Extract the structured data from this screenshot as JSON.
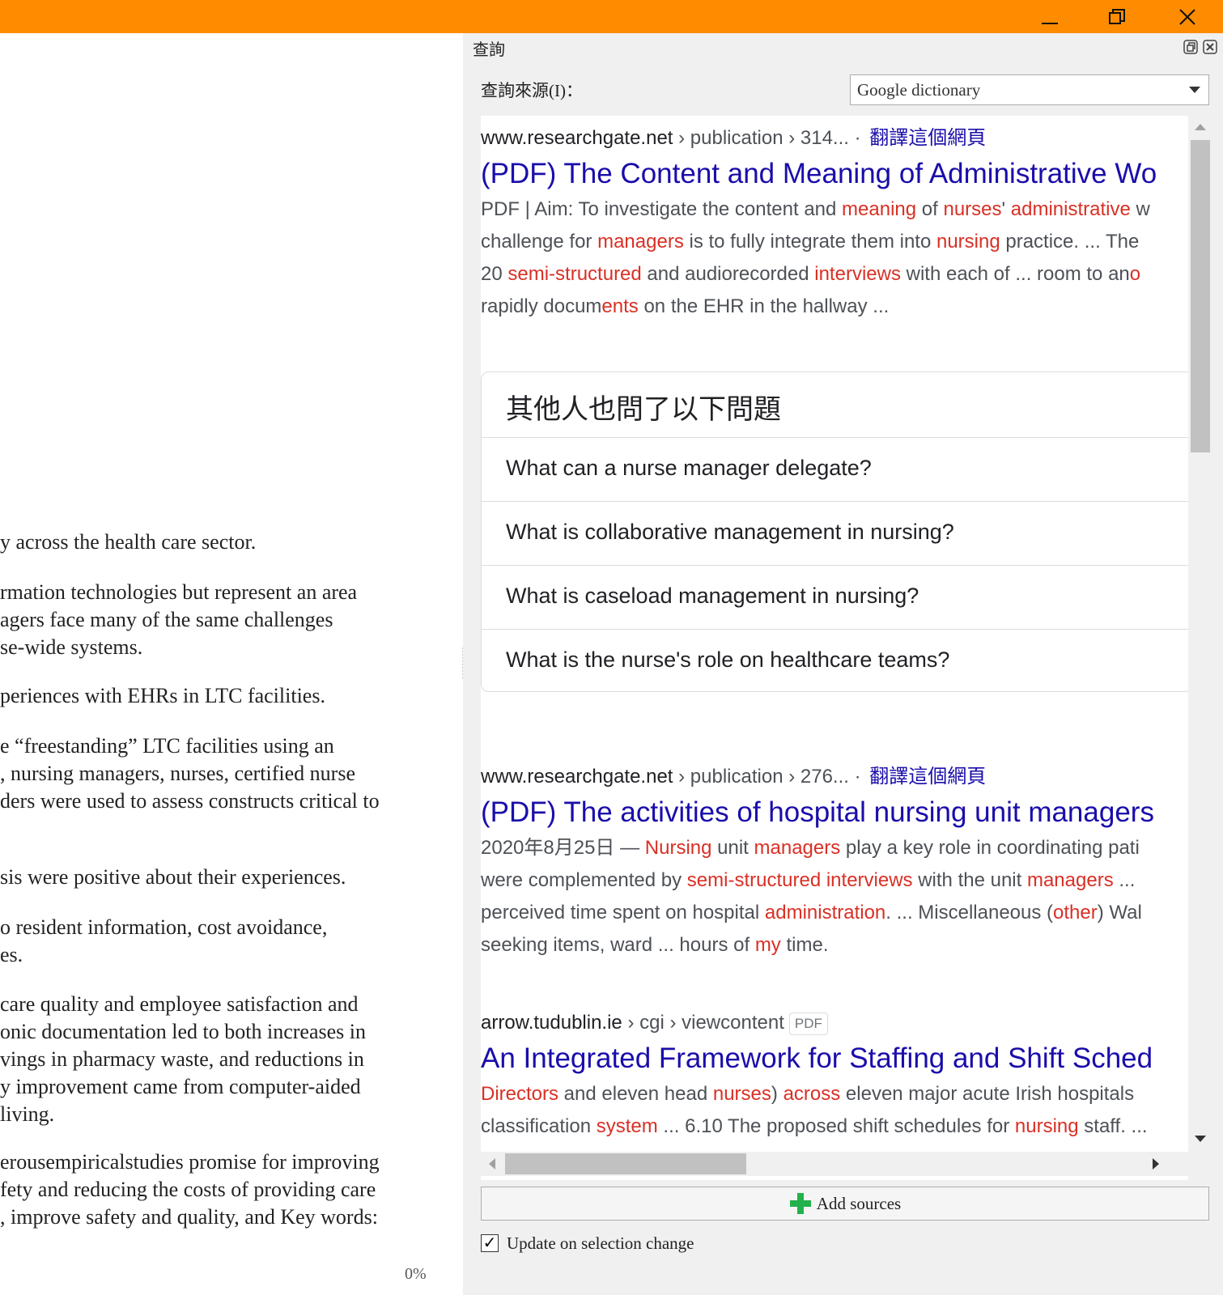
{
  "window": {
    "accent_color": "#ff8c00",
    "minimize_icon": "minimize-icon",
    "restore_icon": "restore-icon",
    "close_icon": "close-icon"
  },
  "document": {
    "lines_p1": [
      "y across the health care sector."
    ],
    "lines_p2": [
      "rmation technologies but represent an area",
      "agers face many of the same challenges",
      "se-wide systems."
    ],
    "lines_p3": [
      "periences with EHRs in LTC facilities."
    ],
    "lines_p4": [
      "e “freestanding” LTC facilities using an",
      ", nursing managers, nurses, certified nurse",
      "ders were used to assess constructs critical to"
    ],
    "lines_p5": [
      "sis were positive about their experiences."
    ],
    "lines_p6": [
      "o resident information, cost avoidance,",
      "es."
    ],
    "lines_p7": [
      "care quality and employee satisfaction and",
      "onic documentation led to both increases in",
      "vings in pharmacy waste, and reductions in",
      "y improvement came from computer-aided",
      "living."
    ],
    "lines_p8": [
      "erousempiricalstudies promise for improving",
      "fety and reducing the costs of providing care",
      ", improve safety and quality, and Key words:"
    ],
    "progress": "0%"
  },
  "panel": {
    "title": "查詢",
    "source_label": "查詢來源(I)：",
    "source_value": "Google dictionary",
    "add_sources_label": "Add sources",
    "update_label": "Update on selection change",
    "update_checked": true
  },
  "results": {
    "r1": {
      "site": "www.researchgate.net",
      "path": " › publication › 314... · ",
      "translate": "翻譯這個網頁",
      "title": "(PDF) The Content and Meaning of Administrative Wo",
      "snippet": [
        [
          [
            "PDF | Aim: To investigate the content and ",
            false
          ],
          [
            "meaning",
            true
          ],
          [
            " of ",
            false
          ],
          [
            "nurses",
            true
          ],
          [
            "' ",
            false
          ],
          [
            "administrative",
            true
          ],
          [
            " w",
            false
          ]
        ],
        [
          [
            "challenge for ",
            false
          ],
          [
            "managers",
            true
          ],
          [
            " is to fully integrate them into ",
            false
          ],
          [
            "nursing",
            true
          ],
          [
            " practice. ... The",
            false
          ]
        ],
        [
          [
            "20 ",
            false
          ],
          [
            "semi-structured",
            true
          ],
          [
            " and audiorecorded ",
            false
          ],
          [
            "interviews",
            true
          ],
          [
            " with each of ... room to an",
            false
          ],
          [
            "o",
            true
          ]
        ],
        [
          [
            "rapidly docum",
            false
          ],
          [
            "ents",
            true
          ],
          [
            " on the EHR in the hallway ...",
            false
          ]
        ]
      ]
    },
    "paa": {
      "heading": "其他人也問了以下問題",
      "q1": "What can a nurse manager delegate?",
      "q2": "What is collaborative management in nursing?",
      "q3": "What is caseload management in nursing?",
      "q4": "What is the nurse's role on healthcare teams?"
    },
    "r2": {
      "site": "www.researchgate.net",
      "path": " › publication › 276... · ",
      "translate": "翻譯這個網頁",
      "title": "(PDF) The activities of hospital nursing unit managers",
      "snippet": [
        [
          [
            "2020年8月25日 — ",
            false
          ],
          [
            "Nursing",
            true
          ],
          [
            " unit ",
            false
          ],
          [
            "managers",
            true
          ],
          [
            " play a key role in coordinating pati",
            false
          ]
        ],
        [
          [
            "were complemented by ",
            false
          ],
          [
            "semi-structured interviews",
            true
          ],
          [
            " with the unit ",
            false
          ],
          [
            "managers",
            true
          ],
          [
            " ...",
            false
          ]
        ],
        [
          [
            "perceived time spent on hospital ",
            false
          ],
          [
            "administration",
            true
          ],
          [
            ". ... Miscellaneous (",
            false
          ],
          [
            "other",
            true
          ],
          [
            ") Wal",
            false
          ]
        ],
        [
          [
            "seeking items, ward ... hours of ",
            false
          ],
          [
            "my",
            true
          ],
          [
            " time.",
            false
          ]
        ]
      ]
    },
    "r3": {
      "site": "arrow.tudublin.ie",
      "path": " › cgi › viewcontent",
      "tag": "PDF",
      "title": "An Integrated Framework for Staffing and Shift Sched",
      "snippet": [
        [
          [
            "Directors",
            true
          ],
          [
            " and eleven head ",
            false
          ],
          [
            "nurses",
            true
          ],
          [
            ") ",
            false
          ],
          [
            "across",
            true
          ],
          [
            " eleven major acute Irish hospitals",
            false
          ]
        ],
        [
          [
            "classification ",
            false
          ],
          [
            "system",
            true
          ],
          [
            " ... 6.10 The proposed shift schedules for ",
            false
          ],
          [
            "nursing",
            true
          ],
          [
            " staff. ...",
            false
          ]
        ]
      ]
    }
  }
}
